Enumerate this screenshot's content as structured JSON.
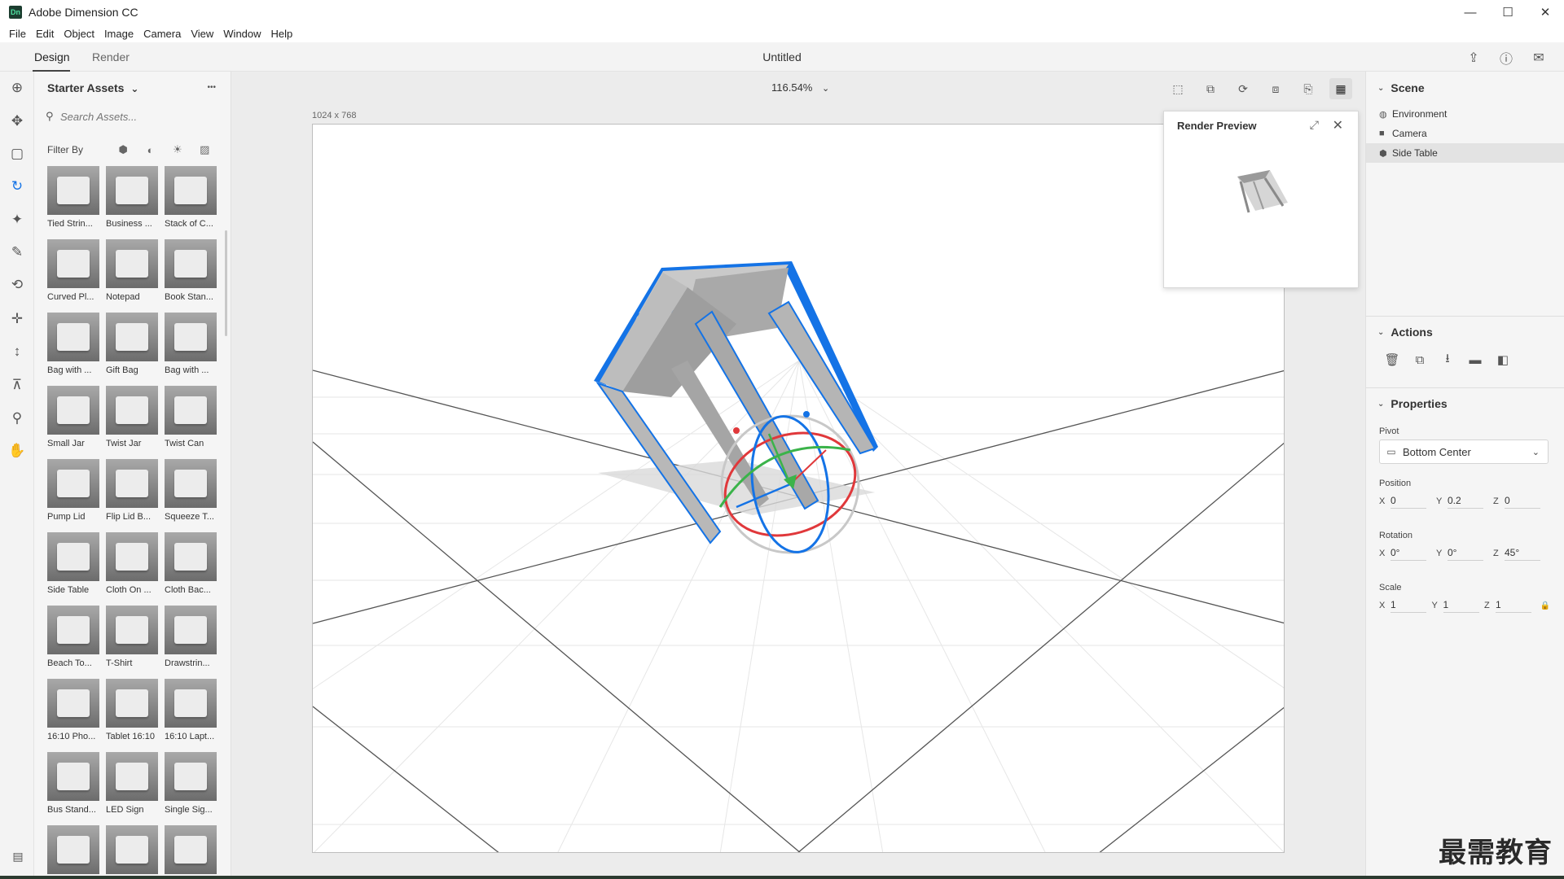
{
  "window": {
    "app_icon_text": "Dn",
    "title": "Adobe Dimension CC",
    "minimize": "—",
    "maximize": "☐",
    "close": "✕"
  },
  "menu": [
    "File",
    "Edit",
    "Object",
    "Image",
    "Camera",
    "View",
    "Window",
    "Help"
  ],
  "modes": {
    "design": "Design",
    "render": "Render",
    "active": "Design"
  },
  "document": {
    "title": "Untitled"
  },
  "top_right_icons": [
    "share-icon",
    "help-icon",
    "comment-icon"
  ],
  "tools": [
    {
      "name": "add-icon",
      "glyph": "⊕"
    },
    {
      "name": "move-icon",
      "glyph": "✥"
    },
    {
      "name": "select-icon",
      "glyph": "▢"
    },
    {
      "name": "orbit-icon",
      "glyph": "↻"
    },
    {
      "name": "magic-wand-icon",
      "glyph": "✦"
    },
    {
      "name": "eyedropper-icon",
      "glyph": "✎"
    },
    {
      "name": "orbit-camera-icon",
      "glyph": "⟲"
    },
    {
      "name": "pan-camera-icon",
      "glyph": "✛"
    },
    {
      "name": "dolly-icon",
      "glyph": "↕"
    },
    {
      "name": "horizon-icon",
      "glyph": "⊼"
    },
    {
      "name": "zoom-icon",
      "glyph": "⚲"
    },
    {
      "name": "hand-icon",
      "glyph": "✋"
    }
  ],
  "assets": {
    "header": "Starter Assets",
    "header_chevron": "⌄",
    "more": "•••",
    "search_placeholder": "Search Assets...",
    "filter_label": "Filter By",
    "filter_icons": [
      "model-filter-icon",
      "material-filter-icon",
      "light-filter-icon",
      "image-filter-icon"
    ],
    "items": [
      "Tied Strin...",
      "Business ...",
      "Stack of C...",
      "Curved Pl...",
      "Notepad",
      "Book Stan...",
      "Bag with ...",
      "Gift Bag",
      "Bag with ...",
      "Small Jar",
      "Twist Jar",
      "Twist Can",
      "Pump Lid",
      "Flip Lid B...",
      "Squeeze T...",
      "Side Table",
      "Cloth On ...",
      "Cloth Bac...",
      "Beach To...",
      "T-Shirt",
      "Drawstrin...",
      "16:10 Pho...",
      "Tablet 16:10",
      "16:10 Lapt...",
      "Bus Stand...",
      "LED Sign",
      "Single Sig...",
      "",
      "",
      ""
    ]
  },
  "canvas": {
    "zoom": "116.54%",
    "size_label": "1024 x 768"
  },
  "render_preview": {
    "title": "Render Preview"
  },
  "scene": {
    "title": "Scene",
    "items": [
      "Environment",
      "Camera",
      "Side Table"
    ],
    "selected": "Side Table"
  },
  "actions": {
    "title": "Actions",
    "icons": [
      "delete-icon",
      "duplicate-icon",
      "import-icon",
      "group-icon",
      "export-icon"
    ]
  },
  "properties": {
    "title": "Properties",
    "pivot_label": "Pivot",
    "pivot_value": "Bottom Center",
    "position_label": "Position",
    "position": {
      "x": "0",
      "y": "0.2",
      "z": "0"
    },
    "rotation_label": "Rotation",
    "rotation": {
      "x": "0°",
      "y": "0°",
      "z": "45°"
    },
    "scale_label": "Scale",
    "scale": {
      "x": "1",
      "y": "1",
      "z": "1"
    }
  },
  "watermark": "最需教育",
  "colors": {
    "accent": "#1473e6",
    "x_axis": "#e0383b",
    "y_axis": "#3bb34a",
    "z_axis": "#1473e6"
  }
}
